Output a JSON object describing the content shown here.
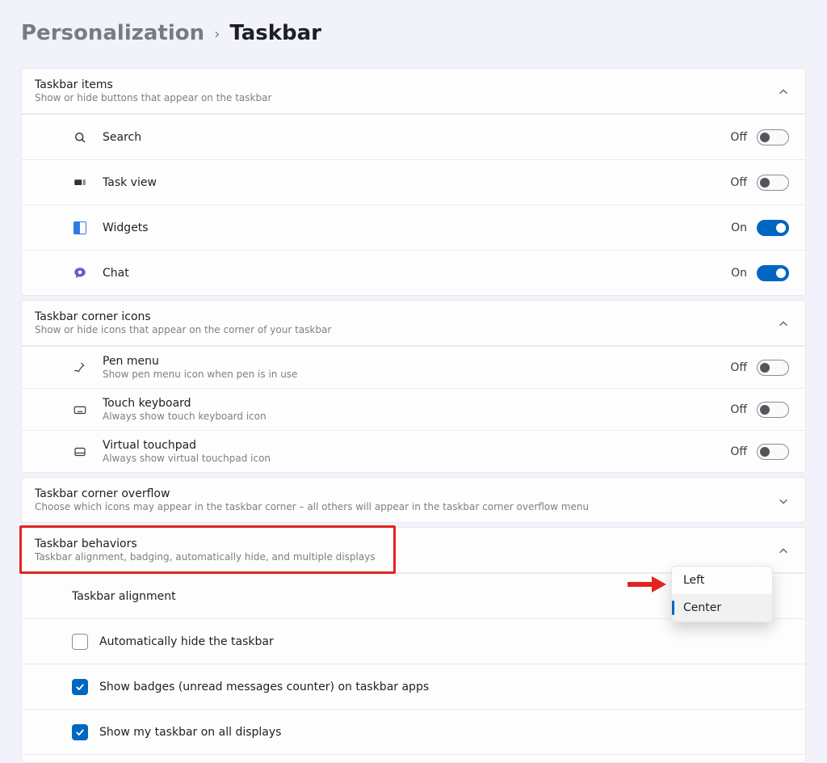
{
  "breadcrumb": {
    "parent": "Personalization",
    "current": "Taskbar"
  },
  "sections": {
    "items": {
      "title": "Taskbar items",
      "subtitle": "Show or hide buttons that appear on the taskbar",
      "rows": [
        {
          "label": "Search",
          "state": "Off",
          "on": false
        },
        {
          "label": "Task view",
          "state": "Off",
          "on": false
        },
        {
          "label": "Widgets",
          "state": "On",
          "on": true
        },
        {
          "label": "Chat",
          "state": "On",
          "on": true
        }
      ]
    },
    "corner_icons": {
      "title": "Taskbar corner icons",
      "subtitle": "Show or hide icons that appear on the corner of your taskbar",
      "rows": [
        {
          "label": "Pen menu",
          "sublabel": "Show pen menu icon when pen is in use",
          "state": "Off",
          "on": false
        },
        {
          "label": "Touch keyboard",
          "sublabel": "Always show touch keyboard icon",
          "state": "Off",
          "on": false
        },
        {
          "label": "Virtual touchpad",
          "sublabel": "Always show virtual touchpad icon",
          "state": "Off",
          "on": false
        }
      ]
    },
    "overflow": {
      "title": "Taskbar corner overflow",
      "subtitle": "Choose which icons may appear in the taskbar corner – all others will appear in the taskbar corner overflow menu"
    },
    "behaviors": {
      "title": "Taskbar behaviors",
      "subtitle": "Taskbar alignment, badging, automatically hide, and multiple displays",
      "alignment_label": "Taskbar alignment",
      "alignment_options": [
        "Left",
        "Center"
      ],
      "alignment_selected": "Center",
      "checks": [
        {
          "label": "Automatically hide the taskbar",
          "on": false
        },
        {
          "label": "Show badges (unread messages counter) on taskbar apps",
          "on": true
        },
        {
          "label": "Show my taskbar on all displays",
          "on": true
        }
      ]
    }
  }
}
